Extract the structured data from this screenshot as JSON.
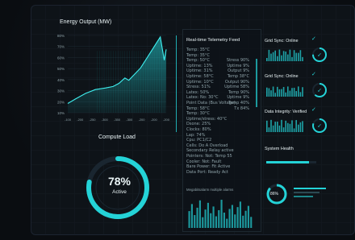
{
  "energy": {
    "title": "Energy Output (MW)",
    "y_ticks": [
      "80%",
      "70%",
      "60%",
      "50%",
      "40%",
      "30%",
      "20%",
      "10%"
    ],
    "x_ticks": [
      "-100",
      "-200",
      "-250",
      "-300",
      "-350",
      "-300",
      "-200",
      "-200",
      "-200"
    ]
  },
  "compute": {
    "title": "Compute Load",
    "percent": "78%",
    "status": "Active",
    "level": 0.78
  },
  "telemetry": {
    "title": "Real-time Telemetry Feed",
    "rows": [
      {
        "label": "Temp: 35°C",
        "value": ""
      },
      {
        "label": "Temp: 35°C",
        "value": ""
      },
      {
        "label": "Temp: 50°C",
        "value": "Stress 90%"
      },
      {
        "label": "Uptime: 13%",
        "value": "Uptime 9%"
      },
      {
        "label": "Uptime: 31%",
        "value": "Output 9%"
      },
      {
        "label": "Uptime: 58°C",
        "value": "Temp 38°C"
      },
      {
        "label": "Uptime: 10°C",
        "value": "Output 90%"
      },
      {
        "label": "Stress: 51%",
        "value": "Uptime 58%"
      },
      {
        "label": "Latex: 50%",
        "value": "Temp 90%"
      },
      {
        "label": "Latex: No: 30°C",
        "value": "Uptime 9%"
      },
      {
        "label": "Point Data (Bus Voltage)",
        "value": "Temp 40%"
      },
      {
        "label": "Temp: 58°C",
        "value": "Tx 84%"
      },
      {
        "label": "Temp: 30°C",
        "value": ""
      },
      {
        "label": "Uptime/stress: 40°C",
        "value": ""
      },
      {
        "label": "Dsone: 25%",
        "value": ""
      },
      {
        "label": "Clocks: 80%",
        "value": ""
      },
      {
        "label": "Lap: 74%",
        "value": ""
      },
      {
        "label": "Cpu: PC1/C2",
        "value": ""
      },
      {
        "label": "Cells: Do A Overload",
        "value": ""
      },
      {
        "label": "Secondary Relay active",
        "value": ""
      },
      {
        "label": "Pointers: Not: Temp 55",
        "value": ""
      },
      {
        "label": "Cooler: Not: Fault",
        "value": ""
      },
      {
        "label": "Bare Power: Fit Active",
        "value": ""
      },
      {
        "label": "Data Port: Ready Act",
        "value": ""
      }
    ],
    "mini_title": "Megabitsalarm multiple alarms",
    "bars": [
      0.55,
      0.78,
      0.42,
      0.66,
      0.9,
      0.35,
      0.6,
      0.82,
      0.48,
      0.7,
      0.38,
      0.58,
      0.92,
      0.5,
      0.3,
      0.62,
      0.75,
      0.44,
      0.68,
      0.86,
      0.4,
      0.56,
      0.72,
      0.36
    ]
  },
  "status": {
    "items": [
      {
        "title": "Grid Sync: Online",
        "level": 0.75
      },
      {
        "title": "Grid Sync: Online",
        "level": 0.62
      },
      {
        "title": "Data Integrity: Verified",
        "level": 0.8
      }
    ],
    "health": {
      "title": "System Health",
      "ring_label": "86%",
      "level": 0.86
    }
  },
  "colors": {
    "accent": "#24d3d7",
    "bg": "#0e1318",
    "text": "#e9f3f5"
  }
}
